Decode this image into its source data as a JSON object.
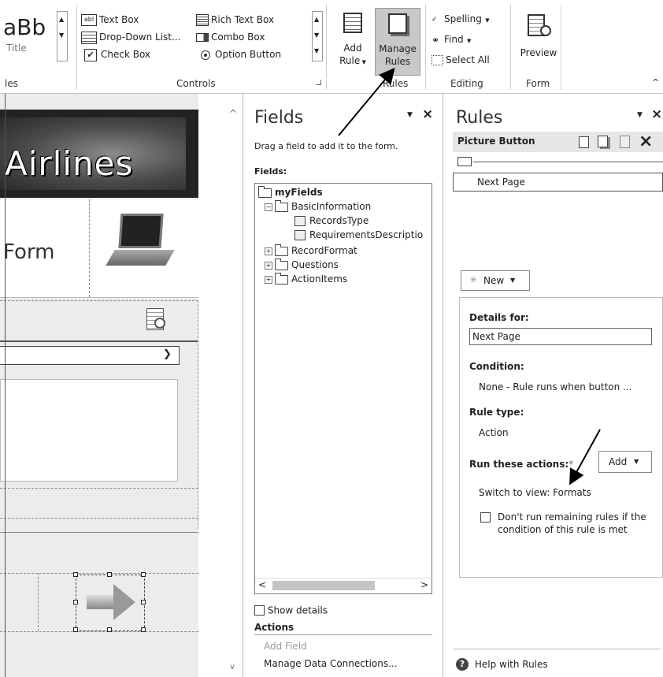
{
  "ribbon": {
    "styles": {
      "sample_text": "aBb",
      "sample_caption": "Title",
      "group_label": "les"
    },
    "controls": {
      "items": [
        {
          "label": "Text Box",
          "icon": "text-box-icon"
        },
        {
          "label": "Rich Text Box",
          "icon": "rich-text-box-icon"
        },
        {
          "label": "Drop-Down List...",
          "icon": "drop-down-list-icon"
        },
        {
          "label": "Combo Box",
          "icon": "combo-box-icon"
        },
        {
          "label": "Check Box",
          "icon": "check-box-icon"
        },
        {
          "label": "Option Button",
          "icon": "option-button-icon"
        }
      ],
      "group_label": "Controls"
    },
    "rules": {
      "add_rule_label": "Add",
      "add_rule_label2": "Rule",
      "manage_rules_label": "Manage",
      "manage_rules_label2": "Rules",
      "group_label": "Rules"
    },
    "editing": {
      "spelling_label": "Spelling",
      "find_label": "Find",
      "select_all_label": "Select All",
      "group_label": "Editing"
    },
    "form": {
      "preview_label": "Preview",
      "group_label": "Form"
    }
  },
  "canvas": {
    "banner_text": "Airlines",
    "form_title": "Form"
  },
  "fields_pane": {
    "title": "Fields",
    "instruction": "Drag a field to add it to the form.",
    "fields_label": "Fields:",
    "tree": [
      {
        "label": "myFields",
        "type": "root"
      },
      {
        "label": "BasicInformation",
        "type": "group-expanded"
      },
      {
        "label": "RecordsType",
        "type": "field"
      },
      {
        "label": "RequirementsDescriptio",
        "type": "field"
      },
      {
        "label": "RecordFormat",
        "type": "group-collapsed"
      },
      {
        "label": "Questions",
        "type": "group-collapsed"
      },
      {
        "label": "ActionItems",
        "type": "group-collapsed"
      }
    ],
    "show_details_label": "Show details",
    "actions_label": "Actions",
    "add_field_label": "Add Field",
    "manage_connections_label": "Manage Data Connections..."
  },
  "rules_pane": {
    "title": "Rules",
    "control_name": "Picture Button",
    "rule_item": "Next Page",
    "new_label": "New",
    "details_for_label": "Details for:",
    "details_for_value": "Next Page",
    "condition_label": "Condition:",
    "condition_value": "None - Rule runs when button ...",
    "rule_type_label": "Rule type:",
    "rule_type_value": "Action",
    "run_actions_label": "Run these actions:",
    "required_mark": "*",
    "add_label": "Add",
    "action_value": "Switch to view: Formats",
    "dont_run_label": "Don't run remaining rules if the condition of this rule is met",
    "help_label": "Help with Rules"
  }
}
